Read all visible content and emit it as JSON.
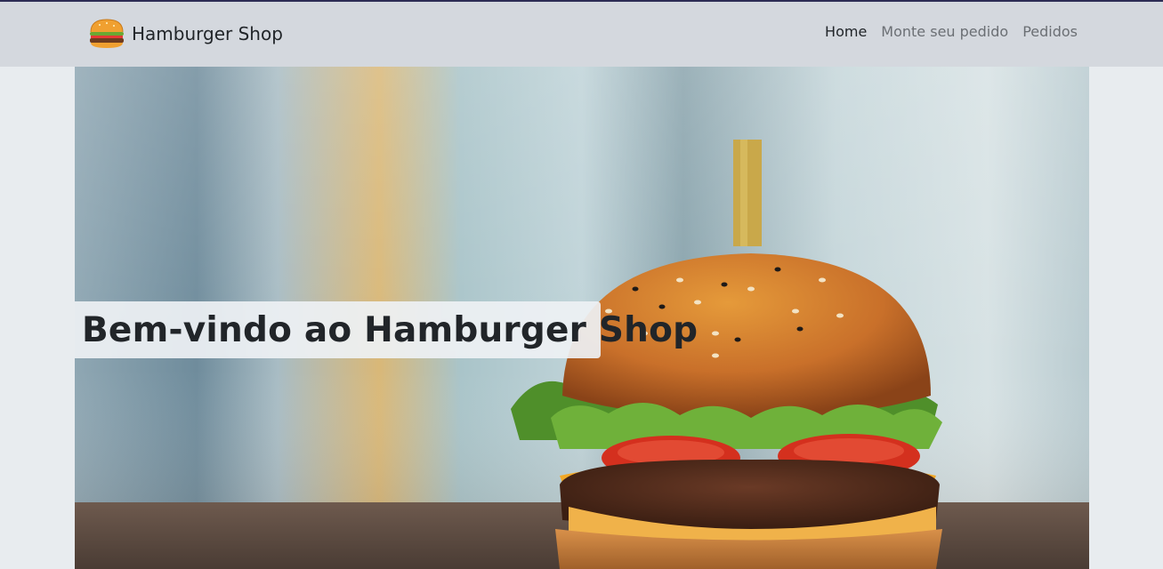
{
  "navbar": {
    "brand": "Hamburger Shop",
    "brand_icon": "hamburger-icon",
    "links": [
      {
        "label": "Home",
        "active": true
      },
      {
        "label": "Monte seu pedido",
        "active": false
      },
      {
        "label": "Pedidos",
        "active": false
      }
    ]
  },
  "hero": {
    "title": "Bem-vindo ao Hamburger Shop",
    "image": "hamburger-photo"
  },
  "colors": {
    "navbar_bg": "#d4d8de",
    "page_bg": "#e8ecef",
    "text": "#212529",
    "link_muted": "#6b6f74"
  }
}
